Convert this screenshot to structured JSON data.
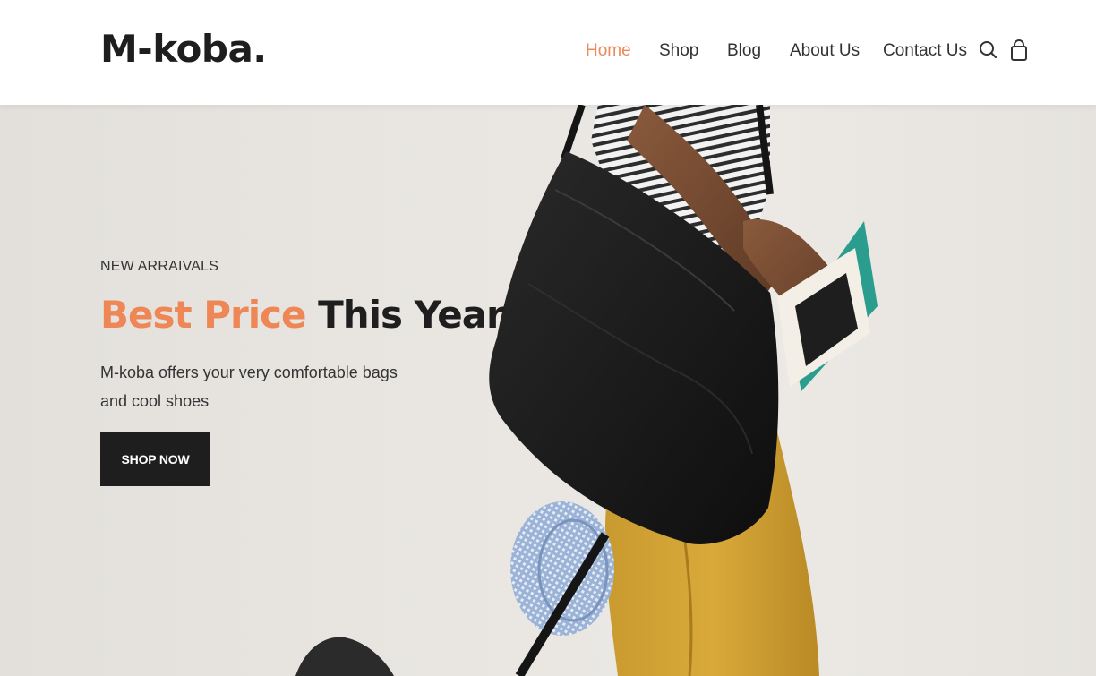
{
  "brand": {
    "logo": "M-koba."
  },
  "nav": {
    "items": [
      {
        "label": "Home",
        "active": true
      },
      {
        "label": "Shop",
        "active": false
      },
      {
        "label": "Blog",
        "active": false
      },
      {
        "label": "About Us",
        "active": false
      },
      {
        "label": "Contact Us",
        "active": false
      }
    ],
    "icons": [
      "search-icon",
      "shopping-bag-icon"
    ]
  },
  "hero": {
    "eyebrow": "NEW ARRAIVALS",
    "headline_accent": "Best Price",
    "headline_rest": "This Year",
    "description": "M-koba offers your very comfortable bags and cool shoes",
    "cta_label": "SHOP NOW",
    "image_subject": "person with black messenger bag"
  },
  "colors": {
    "accent": "#ee8655",
    "nav_active": "#e98b5c",
    "dark": "#1e1e1e",
    "hero_bg": "#e9e6e2"
  }
}
